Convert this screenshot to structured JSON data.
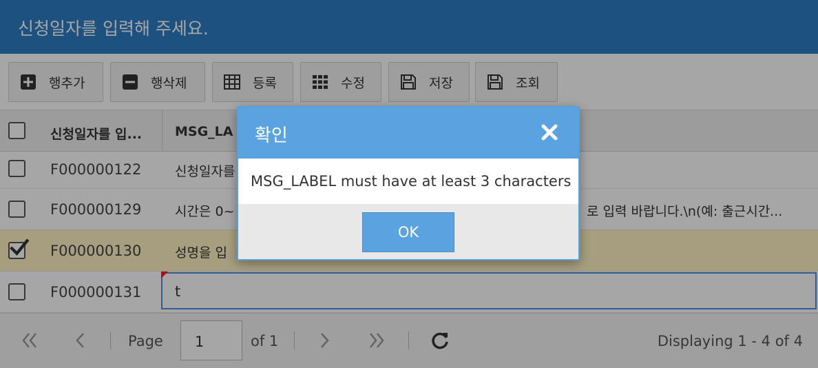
{
  "window": {
    "title": "신청일자를 입력해 주세요."
  },
  "toolbar": {
    "buttons": [
      {
        "label": "행추가",
        "icon": "plus-square-icon"
      },
      {
        "label": "행삭제",
        "icon": "minus-square-icon"
      },
      {
        "label": "등록",
        "icon": "table-icon"
      },
      {
        "label": "수정",
        "icon": "grid-icon"
      },
      {
        "label": "저장",
        "icon": "save-icon"
      },
      {
        "label": "조회",
        "icon": "save-icon"
      }
    ]
  },
  "grid": {
    "columns": [
      "신청일자를 입...",
      "MSG_LA"
    ],
    "rows": [
      {
        "checked": false,
        "id": "F000000122",
        "msg": "신청일자를",
        "msg_tail": ""
      },
      {
        "checked": false,
        "id": "F000000129",
        "msg": "시간은 0~",
        "msg_tail": "로 입력 바랍니다.\\n(예: 출근시간..."
      },
      {
        "checked": true,
        "id": "F000000130",
        "msg": "성명을 입",
        "msg_tail": ""
      },
      {
        "checked": false,
        "id": "F000000131",
        "msg": "t",
        "msg_tail": ""
      }
    ]
  },
  "pager": {
    "page_label": "Page",
    "page_value": "1",
    "of_label": "of 1",
    "display": "Displaying 1 - 4 of 4"
  },
  "dialog": {
    "title": "확인",
    "message": "MSG_LABEL must have at least 3 characters",
    "ok_label": "OK"
  },
  "colors": {
    "header_blue": "#2d7fc5",
    "dialog_blue": "#5aa2e0",
    "selected_row": "#fff3c4"
  }
}
